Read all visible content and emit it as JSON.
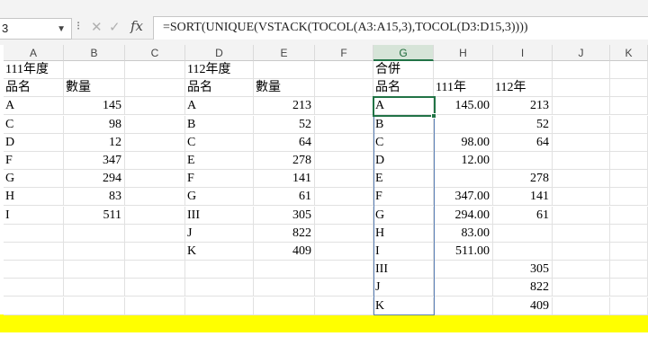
{
  "formula_bar": {
    "name_box": "3",
    "formula": "=SORT(UNIQUE(VSTACK(TOCOL(A3:A15,3),TOCOL(D3:D15,3))))",
    "cancel_glyph": "✕",
    "enter_glyph": "✓",
    "fx_label": "fx"
  },
  "columns": [
    "A",
    "B",
    "C",
    "D",
    "E",
    "F",
    "G",
    "H",
    "I",
    "J",
    "K"
  ],
  "table_111": {
    "title": "111年度",
    "headers": [
      "品名",
      "數量"
    ],
    "rows": [
      [
        "A",
        "145"
      ],
      [
        "C",
        "98"
      ],
      [
        "D",
        "12"
      ],
      [
        "F",
        "347"
      ],
      [
        "G",
        "294"
      ],
      [
        "H",
        "83"
      ],
      [
        "I",
        "511"
      ]
    ]
  },
  "table_112": {
    "title": "112年度",
    "headers": [
      "品名",
      "數量"
    ],
    "rows": [
      [
        "A",
        "213"
      ],
      [
        "B",
        "52"
      ],
      [
        "C",
        "64"
      ],
      [
        "E",
        "278"
      ],
      [
        "F",
        "141"
      ],
      [
        "G",
        "61"
      ],
      [
        "III",
        "305"
      ],
      [
        "J",
        "822"
      ],
      [
        "K",
        "409"
      ]
    ]
  },
  "merged": {
    "title": "合併",
    "headers": [
      "品名",
      "111年",
      "112年"
    ],
    "rows": [
      [
        "A",
        "145.00",
        "213"
      ],
      [
        "B",
        "",
        "52"
      ],
      [
        "C",
        "98.00",
        "64"
      ],
      [
        "D",
        "12.00",
        ""
      ],
      [
        "E",
        "",
        "278"
      ],
      [
        "F",
        "347.00",
        "141"
      ],
      [
        "G",
        "294.00",
        "61"
      ],
      [
        "H",
        "83.00",
        ""
      ],
      [
        "I",
        "511.00",
        ""
      ],
      [
        "III",
        "",
        "305"
      ],
      [
        "J",
        "",
        "822"
      ],
      [
        "K",
        "",
        "409"
      ]
    ]
  },
  "colors": {
    "highlight_row": "#ffff00",
    "selection": "#217346",
    "spill_border": "#5a7fb5"
  }
}
